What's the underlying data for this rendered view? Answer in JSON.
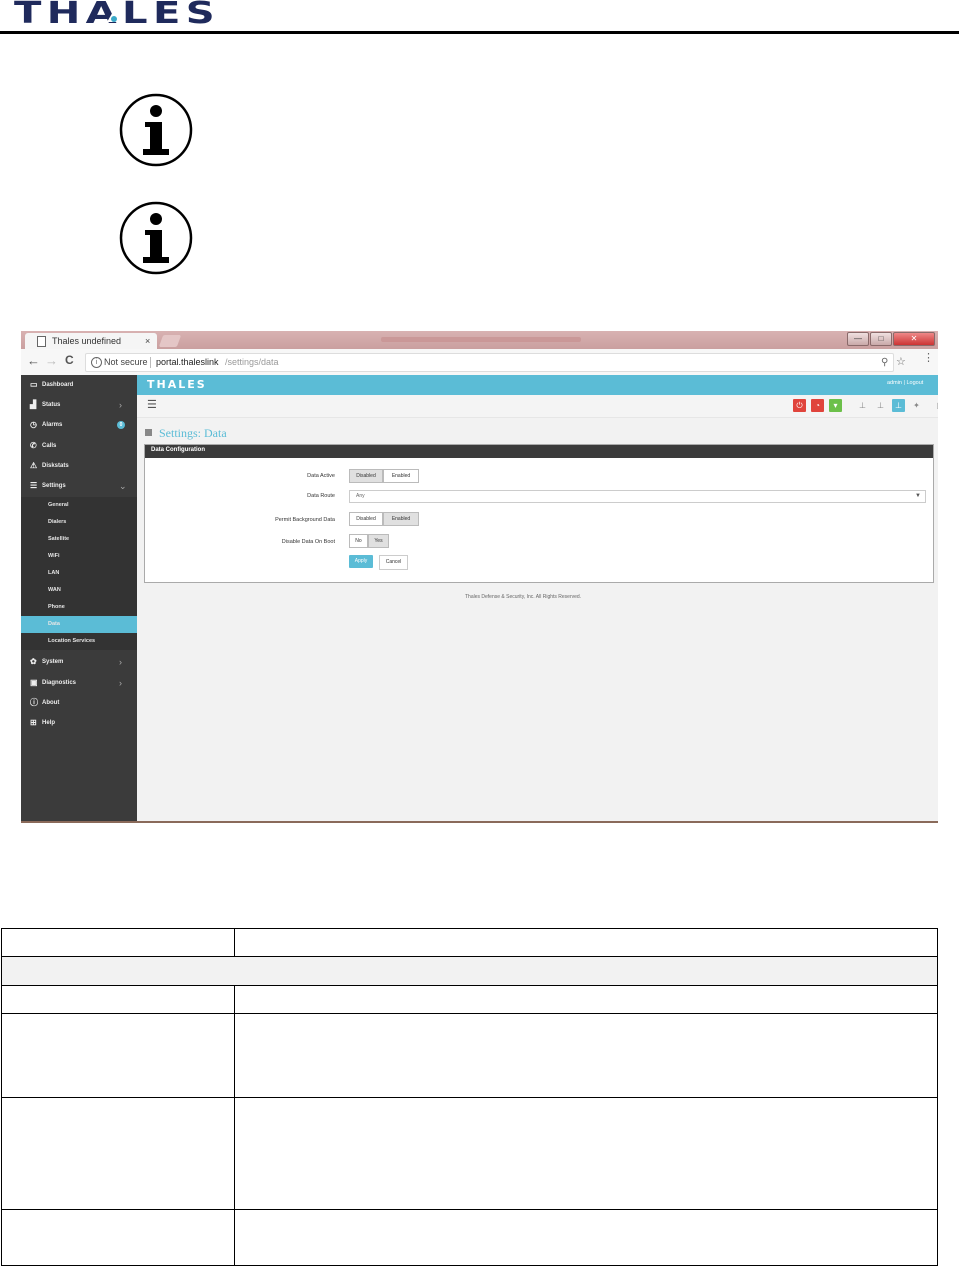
{
  "doc": {
    "logo_text": "THALES"
  },
  "browser": {
    "tab_title": "Thales undefined",
    "tab_close": "×",
    "nav_back": "←",
    "nav_forward": "→",
    "nav_reload": "C",
    "security_text": "Not secure",
    "url_host": "portal.thaleslink",
    "url_path": "/settings/data",
    "window_controls": [
      "—",
      "□",
      "✕"
    ]
  },
  "app": {
    "logo": "THALES",
    "user_link": "admin | Logout",
    "page_title": "Settings: Data",
    "panel_title": "Data Configuration",
    "footer": "Thales Defense & Security, Inc. All Rights Reserved."
  },
  "sidebar": {
    "items": [
      {
        "label": "Dashboard",
        "icon": "monitor-icon",
        "glyph": "▭"
      },
      {
        "label": "Status",
        "icon": "bar-chart-icon",
        "glyph": "▟",
        "chevron": "›"
      },
      {
        "label": "Alarms",
        "icon": "alarm-icon",
        "glyph": "◷",
        "badge": "0"
      },
      {
        "label": "Calls",
        "icon": "phone-icon",
        "glyph": "✆"
      },
      {
        "label": "Diskstats",
        "icon": "warning-icon",
        "glyph": "⚠"
      },
      {
        "label": "Settings",
        "icon": "settings-icon",
        "glyph": "☰",
        "chevron": "⌄"
      }
    ],
    "sub_items": [
      "General",
      "Dialers",
      "Satellite",
      "WiFi",
      "LAN",
      "WAN",
      "Phone",
      "Data",
      "Location Services"
    ],
    "active_sub": "Data",
    "bottom_items": [
      {
        "label": "System",
        "icon": "gear-icon",
        "glyph": "✿",
        "chevron": "›"
      },
      {
        "label": "Diagnostics",
        "icon": "briefcase-icon",
        "glyph": "▣",
        "chevron": "›"
      },
      {
        "label": "About",
        "icon": "info-circle-icon",
        "glyph": "ⓘ"
      },
      {
        "label": "Help",
        "icon": "plus-square-icon",
        "glyph": "⊞"
      }
    ]
  },
  "form": {
    "data_active": {
      "label": "Data Active",
      "options": [
        "Disabled",
        "Enabled"
      ],
      "selected": "Disabled"
    },
    "data_route": {
      "label": "Data Route",
      "value": "Any",
      "caret": "▼"
    },
    "permit_background": {
      "label": "Permit Background Data",
      "options": [
        "Disabled",
        "Enabled"
      ],
      "selected": "Enabled"
    },
    "disable_on_boot": {
      "label": "Disable Data On Boot",
      "options": [
        "No",
        "Yes"
      ],
      "selected": "Yes"
    },
    "apply_label": "Apply",
    "cancel_label": "Cancel"
  },
  "colors": {
    "accent": "#5bbcd6",
    "sidebar": "#3b3b3b",
    "power_red": "#e0443c",
    "rss_red": "#e0443c",
    "wifi_green": "#6cc04a"
  }
}
